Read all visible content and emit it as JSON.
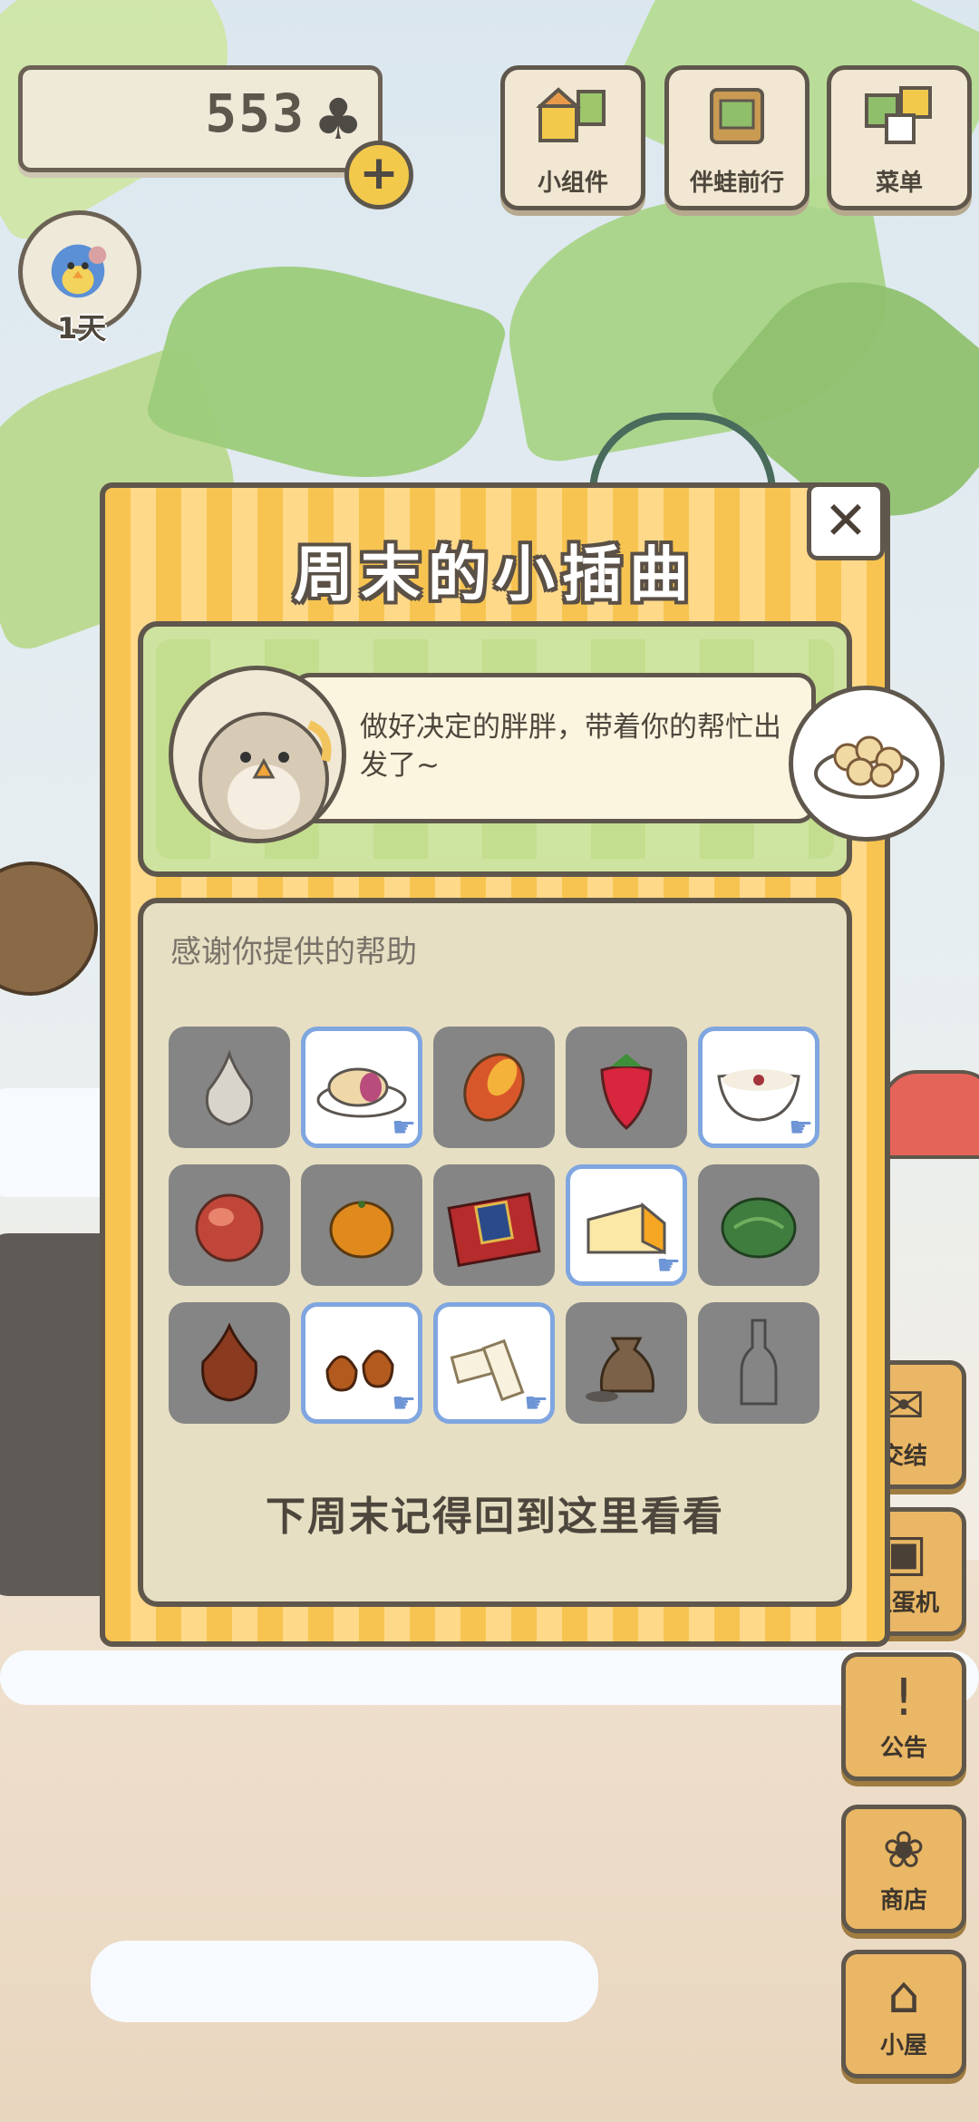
{
  "hud": {
    "coins": "553",
    "coin_icon": "clover-icon",
    "day_badge": "1天",
    "top_buttons": [
      {
        "label": "小组件",
        "icon": "widget-icon"
      },
      {
        "label": "伴蛙前行",
        "icon": "journal-icon"
      },
      {
        "label": "菜单",
        "icon": "menu-icon"
      }
    ]
  },
  "side_buttons": [
    {
      "label": "交结",
      "icon": "mail-icon"
    },
    {
      "label": "扭蛋机",
      "icon": "gacha-icon"
    },
    {
      "label": "公告",
      "icon": "notice-icon"
    },
    {
      "label": "商店",
      "icon": "shop-icon"
    },
    {
      "label": "小屋",
      "icon": "house-icon"
    }
  ],
  "modal": {
    "title": "周末的小插曲",
    "close_icon": "close-icon",
    "dialog_text": "做好决定的胖胖，带着你的帮忙出发了~",
    "thanks_title": "感谢你提供的帮助",
    "footer_note": "下周末记得回到这里看看",
    "items": [
      {
        "name": "garlic",
        "selected": false
      },
      {
        "name": "mooncake",
        "selected": true
      },
      {
        "name": "mango",
        "selected": false
      },
      {
        "name": "strawberry",
        "selected": false
      },
      {
        "name": "porridge",
        "selected": true
      },
      {
        "name": "peach",
        "selected": false
      },
      {
        "name": "tangerine",
        "selected": false
      },
      {
        "name": "gift-box",
        "selected": false
      },
      {
        "name": "cheese",
        "selected": true
      },
      {
        "name": "cabbage",
        "selected": false
      },
      {
        "name": "onion",
        "selected": false
      },
      {
        "name": "chestnuts",
        "selected": true
      },
      {
        "name": "nougat",
        "selected": true
      },
      {
        "name": "rice-sack",
        "selected": false
      },
      {
        "name": "bottle",
        "selected": false
      }
    ]
  },
  "colors": {
    "modal_stripe_a": "#f8c451",
    "modal_stripe_b": "#ffd98a",
    "selected_border": "#7fa6e0",
    "outline": "#5f574c"
  }
}
